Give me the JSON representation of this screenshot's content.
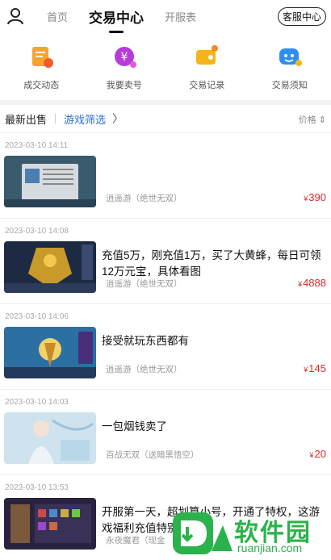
{
  "header": {
    "tabs": [
      {
        "label": "首页"
      },
      {
        "label": "交易中心"
      },
      {
        "label": "开服表"
      }
    ],
    "service_label": "客服中心"
  },
  "quick_links": [
    {
      "label": "成交动态",
      "icon": "orders-icon",
      "color": "#f59a1c"
    },
    {
      "label": "我要卖号",
      "icon": "sell-yuan-icon",
      "color": "#b63cd9"
    },
    {
      "label": "交易记录",
      "icon": "wallet-icon",
      "color": "#f4b21b"
    },
    {
      "label": "交易须知",
      "icon": "chat-notice-icon",
      "color": "#2e8ff0"
    }
  ],
  "filter": {
    "latest_label": "最新出售",
    "filter_label": "游戏筛选",
    "price_label": "价格"
  },
  "listings": [
    {
      "time": "2023-03-10 14:11",
      "title": "",
      "server": "逍遥游（绝世无双）",
      "price": "390"
    },
    {
      "time": "2023-03-10 14:08",
      "title": "充值5万，刚充值1万，买了大黄蜂，每日可领12万元宝，具体看图",
      "server": "逍遥游（绝世无双）",
      "price": "4888"
    },
    {
      "time": "2023-03-10 14:06",
      "title": "接受就玩东西都有",
      "server": "逍遥游（绝世无双）",
      "price": "145"
    },
    {
      "time": "2023-03-10 14:03",
      "title": "一包烟钱卖了",
      "server": "百战无双（送暗黑悟空）",
      "price": "20"
    },
    {
      "time": "2023-03-10 13:53",
      "title": "开服第一天，超划算小号，开通了特权，这游戏福利充值特别多",
      "server": "永夜魔君（现金",
      "price": ""
    }
  ],
  "currency_symbol": "¥",
  "watermark": {
    "main": "软件园",
    "sub": "ruanjian.com",
    "accent": "#2bb24c"
  }
}
